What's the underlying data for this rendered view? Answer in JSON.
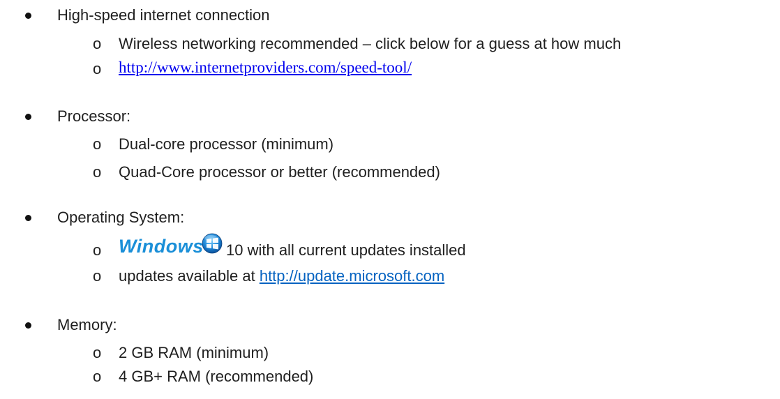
{
  "sections": [
    {
      "label": "High-speed internet connection",
      "items": [
        "Wireless networking recommended – click below for a guess at how much",
        "http://www.internetproviders.com/speed-tool/"
      ]
    },
    {
      "label": "Processor:",
      "items": [
        "Dual-core processor (minimum)",
        "Quad-Core processor or better (recommended)"
      ]
    },
    {
      "label": "Operating System:",
      "items": [
        "10 with all current updates installed",
        "updates available at"
      ],
      "windows_text": "Windows®",
      "update_link": "http://update.microsoft.com"
    },
    {
      "label": "Memory:",
      "items": [
        "2 GB RAM (minimum)",
        "4 GB+ RAM (recommended)"
      ]
    }
  ],
  "sub_marker": "o",
  "icons": {
    "windows_logo": "windows-logo-icon"
  },
  "colors": {
    "link_serif": "#0000ee",
    "link_sans": "#0563c1",
    "windows_blue": "#1a8fd8"
  }
}
